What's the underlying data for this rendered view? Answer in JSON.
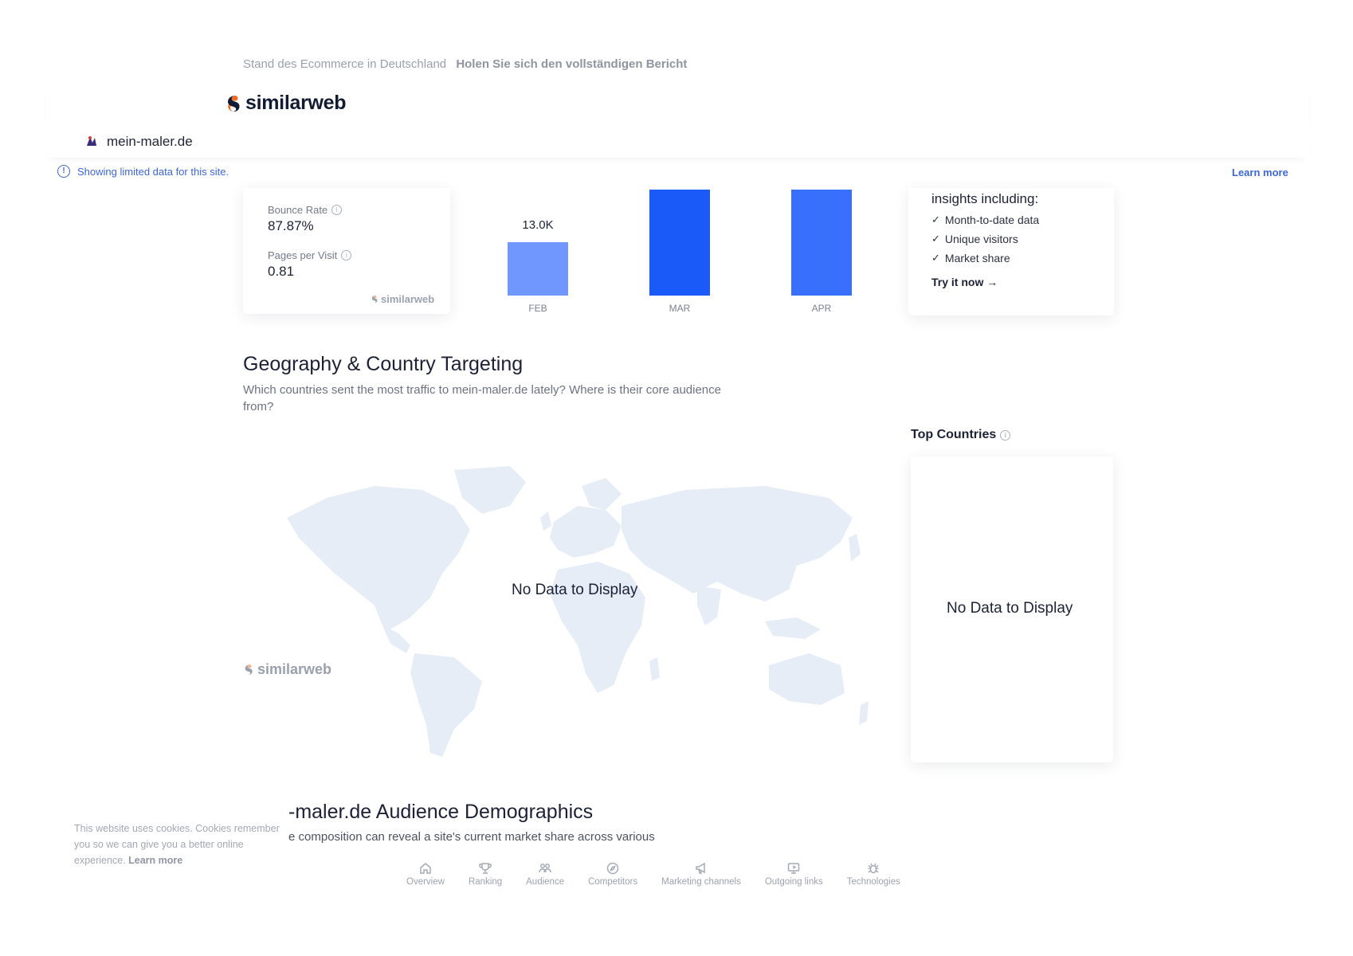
{
  "promo": {
    "text": "Stand des Ecommerce in Deutschland",
    "link": "Holen Sie sich den vollständigen Bericht"
  },
  "brand": {
    "name": "similarweb",
    "icon": "similarweb-logo-icon"
  },
  "site": {
    "domain": "mein-maler.de",
    "icon": "site-favicon-icon"
  },
  "notice": {
    "text": "Showing limited data for this site.",
    "learn_more": "Learn more"
  },
  "engagement": {
    "bounce_rate_label": "Bounce Rate",
    "bounce_rate_value": "87.87%",
    "pages_per_visit_label": "Pages per Visit",
    "pages_per_visit_value": "0.81",
    "watermark": "similarweb"
  },
  "chart_data": {
    "type": "bar",
    "categories": [
      "FEB",
      "MAR",
      "APR"
    ],
    "values": [
      13000,
      null,
      null
    ],
    "data_labels": [
      "13.0K",
      "",
      ""
    ],
    "colors": [
      "#7097fd",
      "#1a5af9",
      "#3870fb"
    ]
  },
  "insights": {
    "title": "insights including:",
    "items": [
      "Month-to-date data",
      "Unique visitors",
      "Market share"
    ],
    "cta": "Try it now →"
  },
  "geography": {
    "title": "Geography & Country Targeting",
    "description": "Which countries sent the most traffic to mein-maler.de lately? Where is their core audience from?",
    "map_empty": "No Data to Display",
    "watermark": "similarweb",
    "top_countries_label": "Top Countries",
    "top_countries_empty": "No Data to Display"
  },
  "demographics": {
    "title": "-maler.de Audience Demographics",
    "description": "e composition can reveal a site's current market share across various"
  },
  "cookie": {
    "text": "This website uses cookies. Cookies remember you so we can give you a better online experience.",
    "link": "Learn more"
  },
  "bottom_nav": [
    {
      "label": "Overview",
      "icon": "home-icon"
    },
    {
      "label": "Ranking",
      "icon": "trophy-icon"
    },
    {
      "label": "Audience",
      "icon": "users-icon"
    },
    {
      "label": "Competitors",
      "icon": "compass-icon"
    },
    {
      "label": "Marketing channels",
      "icon": "megaphone-icon"
    },
    {
      "label": "Outgoing links",
      "icon": "monitor-link-icon"
    },
    {
      "label": "Technologies",
      "icon": "bug-icon"
    }
  ],
  "colors": {
    "accent_blue": "#3b67d6",
    "logo_orange": "#f26b21",
    "logo_navy": "#111c33",
    "map_fill": "#e6edf6"
  }
}
